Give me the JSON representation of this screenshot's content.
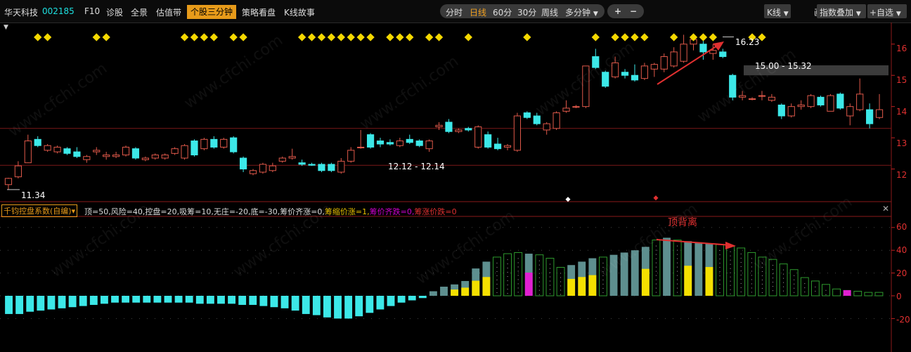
{
  "toolbar": {
    "stock_name": "华天科技",
    "stock_code": "002185",
    "f10": "F10",
    "diagnose": "诊股",
    "full_view": "全景",
    "valuation": "估值带",
    "active_tab": "个股三分钟",
    "strategy": "策略看盘",
    "kline_story": "K线故事",
    "periods": [
      "分时",
      "日线",
      "60分",
      "30分",
      "周线",
      "多分钟"
    ],
    "active_period": "日线",
    "zoom_in": "+",
    "zoom_out": "−",
    "kline_menu": "K线",
    "draw": "画线",
    "overlay": "指数叠加",
    "add_watch": "+自选"
  },
  "price_chart": {
    "annotations": {
      "low": "11.34",
      "high": "16.23",
      "range_top": "15.00 - 15.32",
      "range_bottom": "12.12 - 12.14"
    },
    "axis_ticks": [
      "16",
      "15",
      "14",
      "13",
      "12"
    ]
  },
  "indicator": {
    "name": "千钧控盘系数(自编)",
    "params": {
      "main": "顶=50,风险=40,控盘=20,吸筹=10,无庄=-20,底=-30,筹价齐涨=0,",
      "p2": "筹缩价涨=1,",
      "p3": "筹价齐跌=0,",
      "p4": "筹涨价跌=0"
    },
    "close": "✕",
    "divergence_label": "顶背离",
    "axis_ticks": [
      "60",
      "40",
      "20",
      "0",
      "-20"
    ]
  },
  "watermark": "www.cfchi.com",
  "colors": {
    "up": "#e0594a",
    "down": "#3ce8e8",
    "accent": "#e79b1a",
    "marker": "#f5d800"
  },
  "chart_data": {
    "type": "candlestick",
    "ylim": [
      11.0,
      16.4
    ],
    "candles_ohlc": [
      [
        11.5,
        11.72,
        11.34,
        11.7
      ],
      [
        11.75,
        12.25,
        11.7,
        12.1
      ],
      [
        12.2,
        13.1,
        12.2,
        12.9
      ],
      [
        12.95,
        13.05,
        12.7,
        12.75
      ],
      [
        12.6,
        12.8,
        12.55,
        12.75
      ],
      [
        12.55,
        12.75,
        12.5,
        12.7
      ],
      [
        12.65,
        12.7,
        12.45,
        12.5
      ],
      [
        12.55,
        12.7,
        12.35,
        12.4
      ],
      [
        12.3,
        12.45,
        12.2,
        12.4
      ],
      [
        12.55,
        12.7,
        12.45,
        12.6
      ],
      [
        12.4,
        12.55,
        12.3,
        12.45
      ],
      [
        12.4,
        12.55,
        12.35,
        12.45
      ],
      [
        12.45,
        12.75,
        12.4,
        12.7
      ],
      [
        12.65,
        12.7,
        12.3,
        12.35
      ],
      [
        12.3,
        12.4,
        12.25,
        12.35
      ],
      [
        12.35,
        12.5,
        12.3,
        12.45
      ],
      [
        12.35,
        12.5,
        12.3,
        12.45
      ],
      [
        12.5,
        12.7,
        12.45,
        12.65
      ],
      [
        12.35,
        12.8,
        12.3,
        12.75
      ],
      [
        12.9,
        12.95,
        12.4,
        12.45
      ],
      [
        12.65,
        13.0,
        12.6,
        12.95
      ],
      [
        12.95,
        13.05,
        12.65,
        12.7
      ],
      [
        12.7,
        13.0,
        12.65,
        12.95
      ],
      [
        13.0,
        13.05,
        12.5,
        12.55
      ],
      [
        12.35,
        12.4,
        11.9,
        12.0
      ],
      [
        11.85,
        12.0,
        11.8,
        11.95
      ],
      [
        11.9,
        12.2,
        11.85,
        12.15
      ],
      [
        11.95,
        12.2,
        11.9,
        12.1
      ],
      [
        12.25,
        12.4,
        12.2,
        12.35
      ],
      [
        12.35,
        12.65,
        12.3,
        12.4
      ],
      [
        12.2,
        12.3,
        12.1,
        12.15
      ],
      [
        12.15,
        12.2,
        12.1,
        12.12
      ],
      [
        12.15,
        12.2,
        11.9,
        11.95
      ],
      [
        12.15,
        12.2,
        11.9,
        11.95
      ],
      [
        11.9,
        12.35,
        11.85,
        12.25
      ],
      [
        12.25,
        12.7,
        12.2,
        12.6
      ],
      [
        12.7,
        13.25,
        12.65,
        12.7
      ],
      [
        13.1,
        13.15,
        12.65,
        12.7
      ],
      [
        12.9,
        13.0,
        12.7,
        12.8
      ],
      [
        12.85,
        12.95,
        12.75,
        12.8
      ],
      [
        12.75,
        13.0,
        12.7,
        12.9
      ],
      [
        12.95,
        13.1,
        12.8,
        12.85
      ],
      [
        12.9,
        12.95,
        12.7,
        12.75
      ],
      [
        12.65,
        12.95,
        12.55,
        12.9
      ],
      [
        13.35,
        13.5,
        13.25,
        13.4
      ],
      [
        13.5,
        13.6,
        13.15,
        13.2
      ],
      [
        13.2,
        13.3,
        13.15,
        13.25
      ],
      [
        13.3,
        13.35,
        13.2,
        13.25
      ],
      [
        12.7,
        13.4,
        12.65,
        13.35
      ],
      [
        13.1,
        13.2,
        12.65,
        12.7
      ],
      [
        12.8,
        13.0,
        12.6,
        12.65
      ],
      [
        12.7,
        12.8,
        12.6,
        12.75
      ],
      [
        12.6,
        13.8,
        12.55,
        13.7
      ],
      [
        13.8,
        13.85,
        13.6,
        13.65
      ],
      [
        13.7,
        13.8,
        13.4,
        13.45
      ],
      [
        13.25,
        13.5,
        13.1,
        13.45
      ],
      [
        13.3,
        13.85,
        13.25,
        13.8
      ],
      [
        13.85,
        14.2,
        13.8,
        13.95
      ],
      [
        14.0,
        14.05,
        13.95,
        14.0
      ],
      [
        14.0,
        15.3,
        13.95,
        15.3
      ],
      [
        15.6,
        15.85,
        15.2,
        15.25
      ],
      [
        15.1,
        15.15,
        14.6,
        14.65
      ],
      [
        14.95,
        15.6,
        14.9,
        15.4
      ],
      [
        15.1,
        15.2,
        14.9,
        15.0
      ],
      [
        15.0,
        15.35,
        14.8,
        14.85
      ],
      [
        14.9,
        15.4,
        14.85,
        15.3
      ],
      [
        15.2,
        15.4,
        14.95,
        15.35
      ],
      [
        15.2,
        15.7,
        15.1,
        15.6
      ],
      [
        15.3,
        15.9,
        15.25,
        15.75
      ],
      [
        15.45,
        16.3,
        15.4,
        16.0
      ],
      [
        16.0,
        16.23,
        15.8,
        16.15
      ],
      [
        16.0,
        16.1,
        15.5,
        15.75
      ],
      [
        15.7,
        16.0,
        15.5,
        15.8
      ],
      [
        15.75,
        15.85,
        15.55,
        15.6
      ],
      [
        15.0,
        15.05,
        14.2,
        14.3
      ],
      [
        14.3,
        14.5,
        14.2,
        14.35
      ],
      [
        14.25,
        14.3,
        14.2,
        14.25
      ],
      [
        14.35,
        14.5,
        14.2,
        14.35
      ],
      [
        14.2,
        14.4,
        14.15,
        14.3
      ],
      [
        14.05,
        14.1,
        13.6,
        13.7
      ],
      [
        13.7,
        14.1,
        13.65,
        14.0
      ],
      [
        14.0,
        14.2,
        13.9,
        14.05
      ],
      [
        14.0,
        14.4,
        13.95,
        14.35
      ],
      [
        14.3,
        14.35,
        14.0,
        14.05
      ],
      [
        13.85,
        14.4,
        13.85,
        14.35
      ],
      [
        14.4,
        14.45,
        13.9,
        13.95
      ],
      [
        13.7,
        14.1,
        13.4,
        14.0
      ],
      [
        13.9,
        14.9,
        13.85,
        14.4
      ],
      [
        13.9,
        14.1,
        13.3,
        13.45
      ],
      [
        13.65,
        14.4,
        13.6,
        13.9
      ]
    ],
    "indicator_values": [
      -16,
      -16,
      -14,
      -13,
      -12,
      -11,
      -10,
      -9,
      -8,
      -7,
      -6,
      -6,
      -6,
      -6,
      -6,
      -6,
      -6,
      -6,
      -7,
      -7,
      -7,
      -7,
      -8,
      -8,
      -9,
      -10,
      -11,
      -13,
      -16,
      -17,
      -19,
      -20,
      -20,
      -18,
      -15,
      -12,
      -9,
      -6,
      -4,
      -2,
      4,
      8,
      10,
      13,
      24,
      30,
      34,
      37,
      38,
      37,
      36,
      33,
      25,
      27,
      30,
      33,
      34,
      36,
      38,
      40,
      43,
      49,
      51,
      49,
      48,
      47,
      46,
      45,
      44,
      42,
      38,
      34,
      32,
      28,
      23,
      16,
      13,
      10,
      6,
      5,
      4,
      3,
      3
    ],
    "indicator_highlight": [
      "cyan",
      "cyan",
      "cyan",
      "cyan",
      "cyan",
      "cyan",
      "cyan",
      "cyan",
      "cyan",
      "cyan",
      "cyan",
      "cyan",
      "cyan",
      "cyan",
      "cyan",
      "cyan",
      "cyan",
      "cyan",
      "cyan",
      "cyan",
      "cyan",
      "cyan",
      "cyan",
      "cyan",
      "cyan",
      "cyan",
      "cyan",
      "cyan",
      "cyan",
      "cyan",
      "cyan",
      "cyan",
      "cyan",
      "cyan",
      "cyan",
      "cyan",
      "cyan",
      "cyan",
      "cyan",
      "cyan",
      "gray",
      "gray",
      "yellow",
      "yellow",
      "yellow",
      "yellow",
      "hollow",
      "hollow",
      "hollow",
      "magenta",
      "hollow",
      "hollow",
      "hollow",
      "yellow",
      "yellow",
      "yellow",
      "hollow",
      "gray",
      "gray",
      "gray",
      "yellow",
      "hollow",
      "gray",
      "hollow",
      "yellow",
      "gray",
      "yellow",
      "hollow",
      "hollow",
      "hollow",
      "hollow",
      "hollow",
      "hollow",
      "hollow",
      "hollow",
      "hollow",
      "hollow",
      "hollow",
      "hollow",
      "magenta",
      "hollow",
      "hollow",
      "hollow"
    ]
  }
}
